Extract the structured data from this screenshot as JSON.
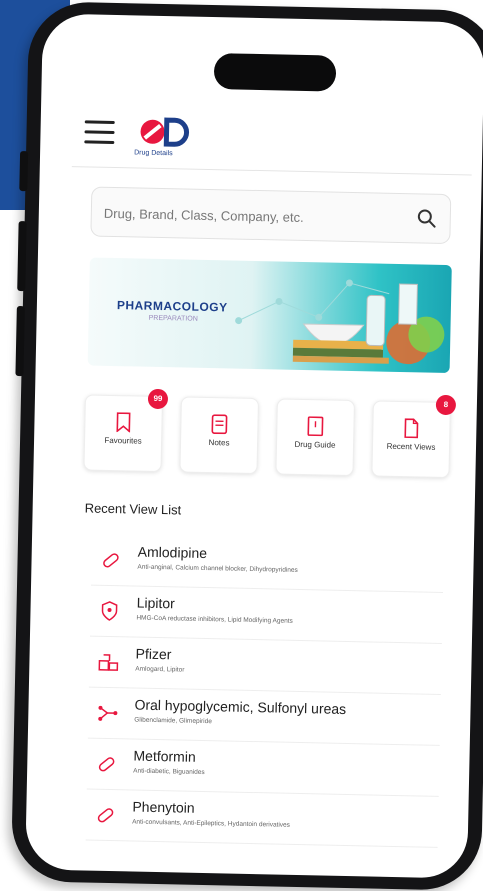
{
  "app": {
    "logo_text": "Drug Details",
    "accent_color": "#e8173f",
    "brand_color": "#1d3f8a"
  },
  "search": {
    "placeholder": "Drug, Brand, Class, Company, etc.",
    "icon": "search-icon"
  },
  "banner": {
    "title": "PHARMACOLOGY",
    "subtitle": "PREPARATION"
  },
  "quick_actions": [
    {
      "label": "Favourites",
      "icon": "bookmark-icon",
      "badge": "99"
    },
    {
      "label": "Notes",
      "icon": "notes-icon",
      "badge": ""
    },
    {
      "label": "Drug Guide",
      "icon": "book-icon",
      "badge": ""
    },
    {
      "label": "Recent Views",
      "icon": "document-icon",
      "badge": "8"
    }
  ],
  "recent": {
    "title": "Recent View List",
    "items": [
      {
        "name": "Amlodipine",
        "sub": "Anti-anginal, Calcium channel blocker, Dihydropyridines",
        "icon": "pill-icon"
      },
      {
        "name": "Lipitor",
        "sub": "HMG-CoA reductase inhibitors, Lipid Modifying Agents",
        "icon": "shield-icon"
      },
      {
        "name": "Pfizer",
        "sub": "Amlogard, Lipitor",
        "icon": "pharmacy-icon"
      },
      {
        "name": "Oral hypoglycemic, Sulfonyl ureas",
        "sub": "Glibenclamide, Glimepiride",
        "icon": "molecule-icon"
      },
      {
        "name": "Metformin",
        "sub": "Anti-diabetic, Biguanides",
        "icon": "pill-icon"
      },
      {
        "name": "Phenytoin",
        "sub": "Anti-convulsants, Anti-Epileptics, Hydantoin derivatives",
        "icon": "pill-icon"
      }
    ]
  }
}
